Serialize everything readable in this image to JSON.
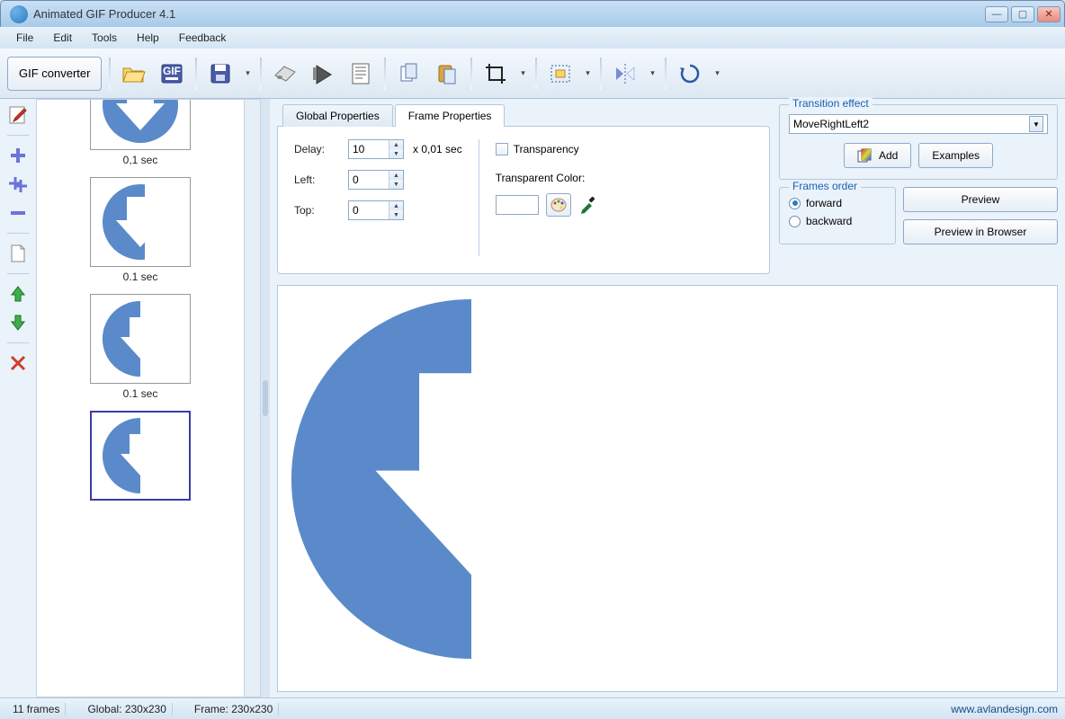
{
  "title": "Animated GIF Producer 4.1",
  "menu": {
    "file": "File",
    "edit": "Edit",
    "tools": "Tools",
    "help": "Help",
    "feedback": "Feedback"
  },
  "toolbar": {
    "gif_converter": "GIF converter"
  },
  "frames": [
    {
      "label": "0,1 sec"
    },
    {
      "label": "0.1 sec"
    },
    {
      "label": "0.1 sec"
    },
    {
      "label": ""
    }
  ],
  "tabs": {
    "global": "Global Properties",
    "frame": "Frame Properties",
    "active": "frame"
  },
  "frame_props": {
    "delay_label": "Delay:",
    "delay_value": "10",
    "delay_suffix": "x 0,01 sec",
    "left_label": "Left:",
    "left_value": "0",
    "top_label": "Top:",
    "top_value": "0",
    "transparency_label": "Transparency",
    "transparent_color_label": "Transparent Color:"
  },
  "transition": {
    "legend": "Transition effect",
    "value": "MoveRightLeft2",
    "add": "Add",
    "examples": "Examples"
  },
  "frames_order": {
    "legend": "Frames order",
    "forward": "forward",
    "backward": "backward",
    "selected": "forward"
  },
  "preview": {
    "preview": "Preview",
    "preview_browser": "Preview in Browser"
  },
  "status": {
    "frames": "11 frames",
    "global": "Global: 230x230",
    "frame": "Frame: 230x230",
    "url": "www.avlandesign.com"
  }
}
